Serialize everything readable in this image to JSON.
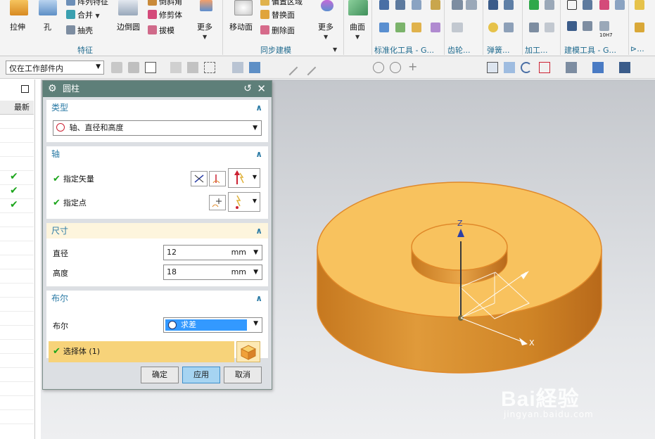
{
  "ribbon": {
    "feature_group": {
      "label": "特征",
      "items": {
        "extrude": "拉伸",
        "hole": "孔",
        "pattern": "阵列特征",
        "unite": "合并",
        "shell": "抽壳",
        "edge_blend": "边倒圆",
        "trim_body": "修剪体",
        "draft": "拔模",
        "chamfer": "倒斜角",
        "more": "更多"
      }
    },
    "sync_group": {
      "label": "同步建模",
      "items": {
        "move_face": "移动面",
        "offset_region": "偏置区域",
        "replace_face": "替换面",
        "delete_face": "删除面",
        "more": "更多"
      }
    },
    "surface_label": "曲面",
    "groups_right": [
      "标准化工具 - G...",
      "齿轮...",
      "弹簧...",
      "加工...",
      "建模工具 - G...",
      "⊳..."
    ],
    "badge_10h7": "10H7"
  },
  "toolbar2": {
    "filter_value": "仅在工作部件内"
  },
  "navigator": {
    "column_header": "最新",
    "checks": [
      "✔",
      "✔",
      "✔"
    ]
  },
  "dialog": {
    "title": "圆柱",
    "type_section": {
      "title": "类型",
      "value": "轴、直径和高度"
    },
    "axis_section": {
      "title": "轴",
      "vector_label": "指定矢量",
      "point_label": "指定点"
    },
    "dimension_section": {
      "title": "尺寸",
      "diameter_label": "直径",
      "diameter_value": "12",
      "diameter_unit": "mm",
      "height_label": "高度",
      "height_value": "18",
      "height_unit": "mm"
    },
    "boolean_section": {
      "title": "布尔",
      "boolean_label": "布尔",
      "boolean_value": "求差",
      "select_body": "选择体 (1)"
    },
    "buttons": {
      "ok": "确定",
      "apply": "应用",
      "cancel": "取消"
    }
  },
  "viewport": {
    "axis_z": "Z",
    "axis_x": "X",
    "model_color": "#f8bf58"
  },
  "watermark": {
    "brand": "Bai経验",
    "url": "jingyan.baidu.com"
  }
}
